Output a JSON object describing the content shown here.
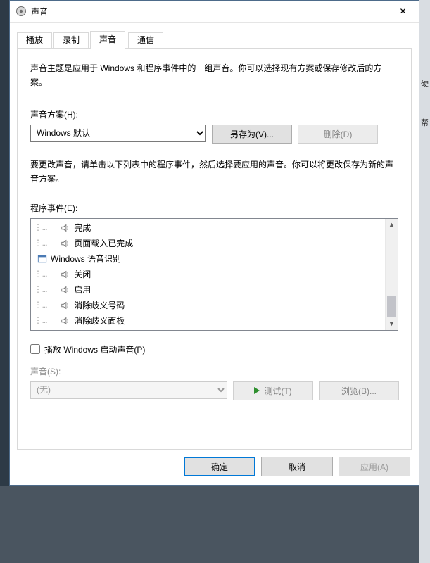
{
  "window": {
    "title": "声音",
    "close_symbol": "✕"
  },
  "tabs": {
    "playback": "播放",
    "recording": "录制",
    "sounds": "声音",
    "comm": "通信"
  },
  "panel": {
    "description": "声音主题是应用于 Windows 和程序事件中的一组声音。你可以选择现有方案或保存修改后的方案。",
    "scheme_label": "声音方案(H):",
    "scheme_value": "Windows 默认",
    "save_as": "另存为(V)...",
    "delete": "删除(D)",
    "events_description": "要更改声音，请单击以下列表中的程序事件，然后选择要应用的声音。你可以将更改保存为新的声音方案。",
    "events_label": "程序事件(E):",
    "events": [
      {
        "indent": 1,
        "icon": "speaker",
        "label": "完成"
      },
      {
        "indent": 1,
        "icon": "speaker",
        "label": "页面载入已完成"
      },
      {
        "indent": 0,
        "icon": "windows",
        "label": "Windows 语音识别"
      },
      {
        "indent": 1,
        "icon": "speaker",
        "label": "关闭"
      },
      {
        "indent": 1,
        "icon": "speaker",
        "label": "启用"
      },
      {
        "indent": 1,
        "icon": "speaker",
        "label": "消除歧义号码"
      },
      {
        "indent": 1,
        "icon": "speaker",
        "label": "消除歧义面板"
      }
    ],
    "play_start_sound": "播放 Windows 启动声音(P)",
    "sound_label": "声音(S):",
    "sound_value": "(无)",
    "test": "测试(T)",
    "browse": "浏览(B)..."
  },
  "footer": {
    "ok": "确定",
    "cancel": "取消",
    "apply": "应用(A)"
  },
  "edge": {
    "r1": "硬",
    "r2": "帮"
  }
}
